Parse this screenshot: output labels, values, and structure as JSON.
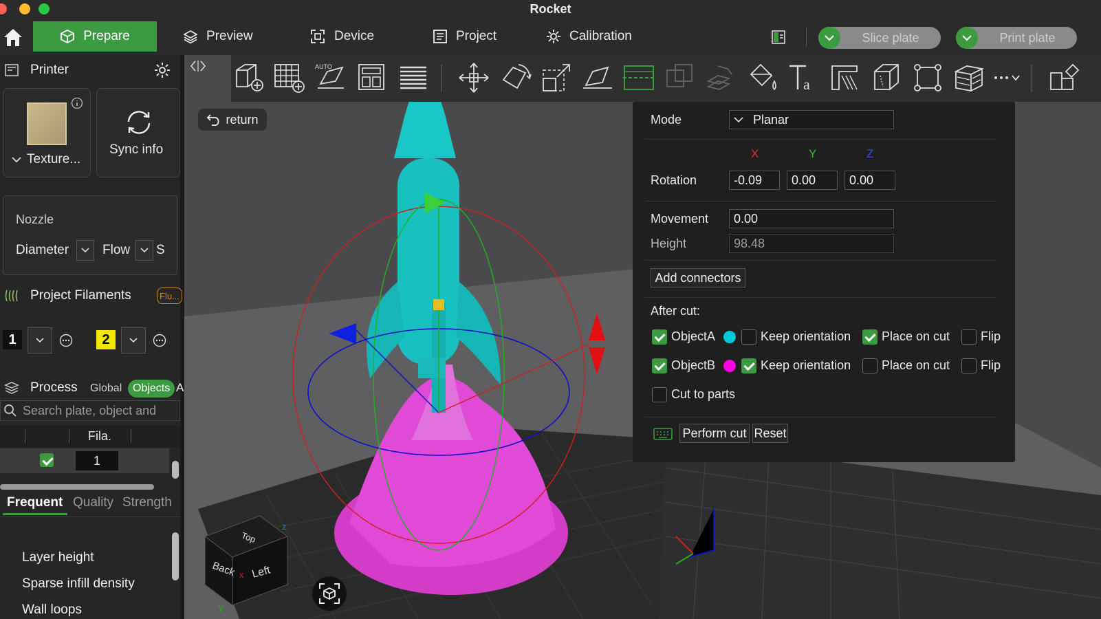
{
  "window": {
    "title": "Rocket",
    "traffic_colors": [
      "#ff5f57",
      "#febc2e",
      "#28c840"
    ]
  },
  "nav": {
    "tabs": [
      {
        "label": "Prepare",
        "icon": "cube-icon",
        "active": true
      },
      {
        "label": "Preview",
        "icon": "layers-icon"
      },
      {
        "label": "Device",
        "icon": "device-icon"
      },
      {
        "label": "Project",
        "icon": "project-icon"
      },
      {
        "label": "Calibration",
        "icon": "calibration-icon"
      }
    ],
    "slice_label": "Slice plate",
    "print_label": "Print plate"
  },
  "left": {
    "printer_title": "Printer",
    "plate_label": "Texture...",
    "sync_label": "Sync info",
    "nozzle_title": "Nozzle",
    "diameter_label": "Diameter",
    "flow_label": "Flow",
    "flow_tail": "S",
    "filaments_title": "Project Filaments",
    "filaments_badge": "Flu...",
    "filament1": "1",
    "filament2": "2",
    "process_title": "Process",
    "global_label": "Global",
    "objects_label": "Objects",
    "objects_tail": "A",
    "search_placeholder": "Search plate, object and",
    "table_header_fila": "Fila.",
    "table_row_value": "1",
    "tabs": {
      "frequent": "Frequent",
      "quality": "Quality",
      "strength": "Strength"
    },
    "list": [
      "Layer height",
      "Sparse infill density",
      "Wall loops"
    ]
  },
  "viewport": {
    "return_label": "return",
    "cube_faces": {
      "top": "Top",
      "back": "Back",
      "left": "Left"
    },
    "axis_labels": {
      "x": "x",
      "y": "y",
      "z": "z"
    }
  },
  "cut": {
    "mode_label": "Mode",
    "mode_value": "Planar",
    "axis_x": "X",
    "axis_y": "Y",
    "axis_z": "Z",
    "rotation_label": "Rotation",
    "rot_x": "-0.09",
    "rot_y": "0.00",
    "rot_z": "0.00",
    "movement_label": "Movement",
    "movement_value": "0.00",
    "height_label": "Height",
    "height_value": "98.48",
    "add_connectors": "Add connectors",
    "after_cut": "After cut:",
    "object_a": "ObjectA",
    "object_b": "ObjectB",
    "keep_orientation": "Keep orientation",
    "place_on_cut": "Place on cut",
    "flip": "Flip",
    "cut_to_parts": "Cut to parts",
    "perform_cut": "Perform cut",
    "reset": "Reset",
    "colors": {
      "object_a": "#00c8d8",
      "object_b": "#ff00e6",
      "accent": "#3c9a40"
    }
  }
}
